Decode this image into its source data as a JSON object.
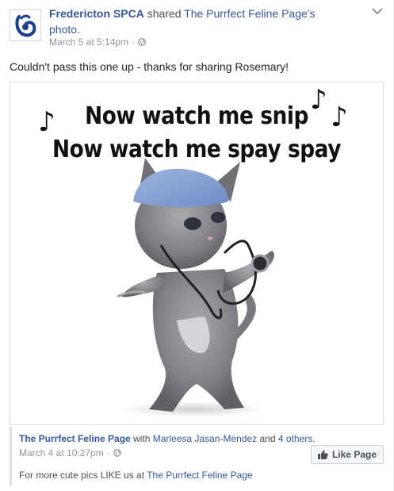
{
  "post": {
    "page_name": "Fredericton SPCA",
    "shared_text": "shared",
    "source_page": "The Purrfect Feline Page's",
    "photo_link": "photo.",
    "timestamp": "March 5 at 5:14pm",
    "separator": "·",
    "status": "Couldn't pass this one up - thanks for sharing Rosemary!",
    "icons": {
      "avatar": "spca-logo-icon",
      "audience": "globe-icon",
      "options": "chevron-down-icon",
      "like": "thumbs-up-icon"
    }
  },
  "photo": {
    "caption_line1": "Now watch me snip",
    "caption_line2": "Now watch me spay spay",
    "note_glyph": "♪"
  },
  "original": {
    "page_name": "The Purrfect Feline Page",
    "with_text": "with",
    "tagged_person": "Marleesa Jasan-Mendez",
    "and_text": "and",
    "others_link": "4 others.",
    "timestamp": "March 4 at 10:27pm",
    "separator": "·",
    "description_prefix": "For more cute pics LIKE us at",
    "description_link": "The Purrfect Feline Page",
    "like_button": "Like Page"
  },
  "colors": {
    "link": "#365899",
    "meta": "#90949c",
    "text": "#1d2129",
    "border": "#dddfe2"
  }
}
